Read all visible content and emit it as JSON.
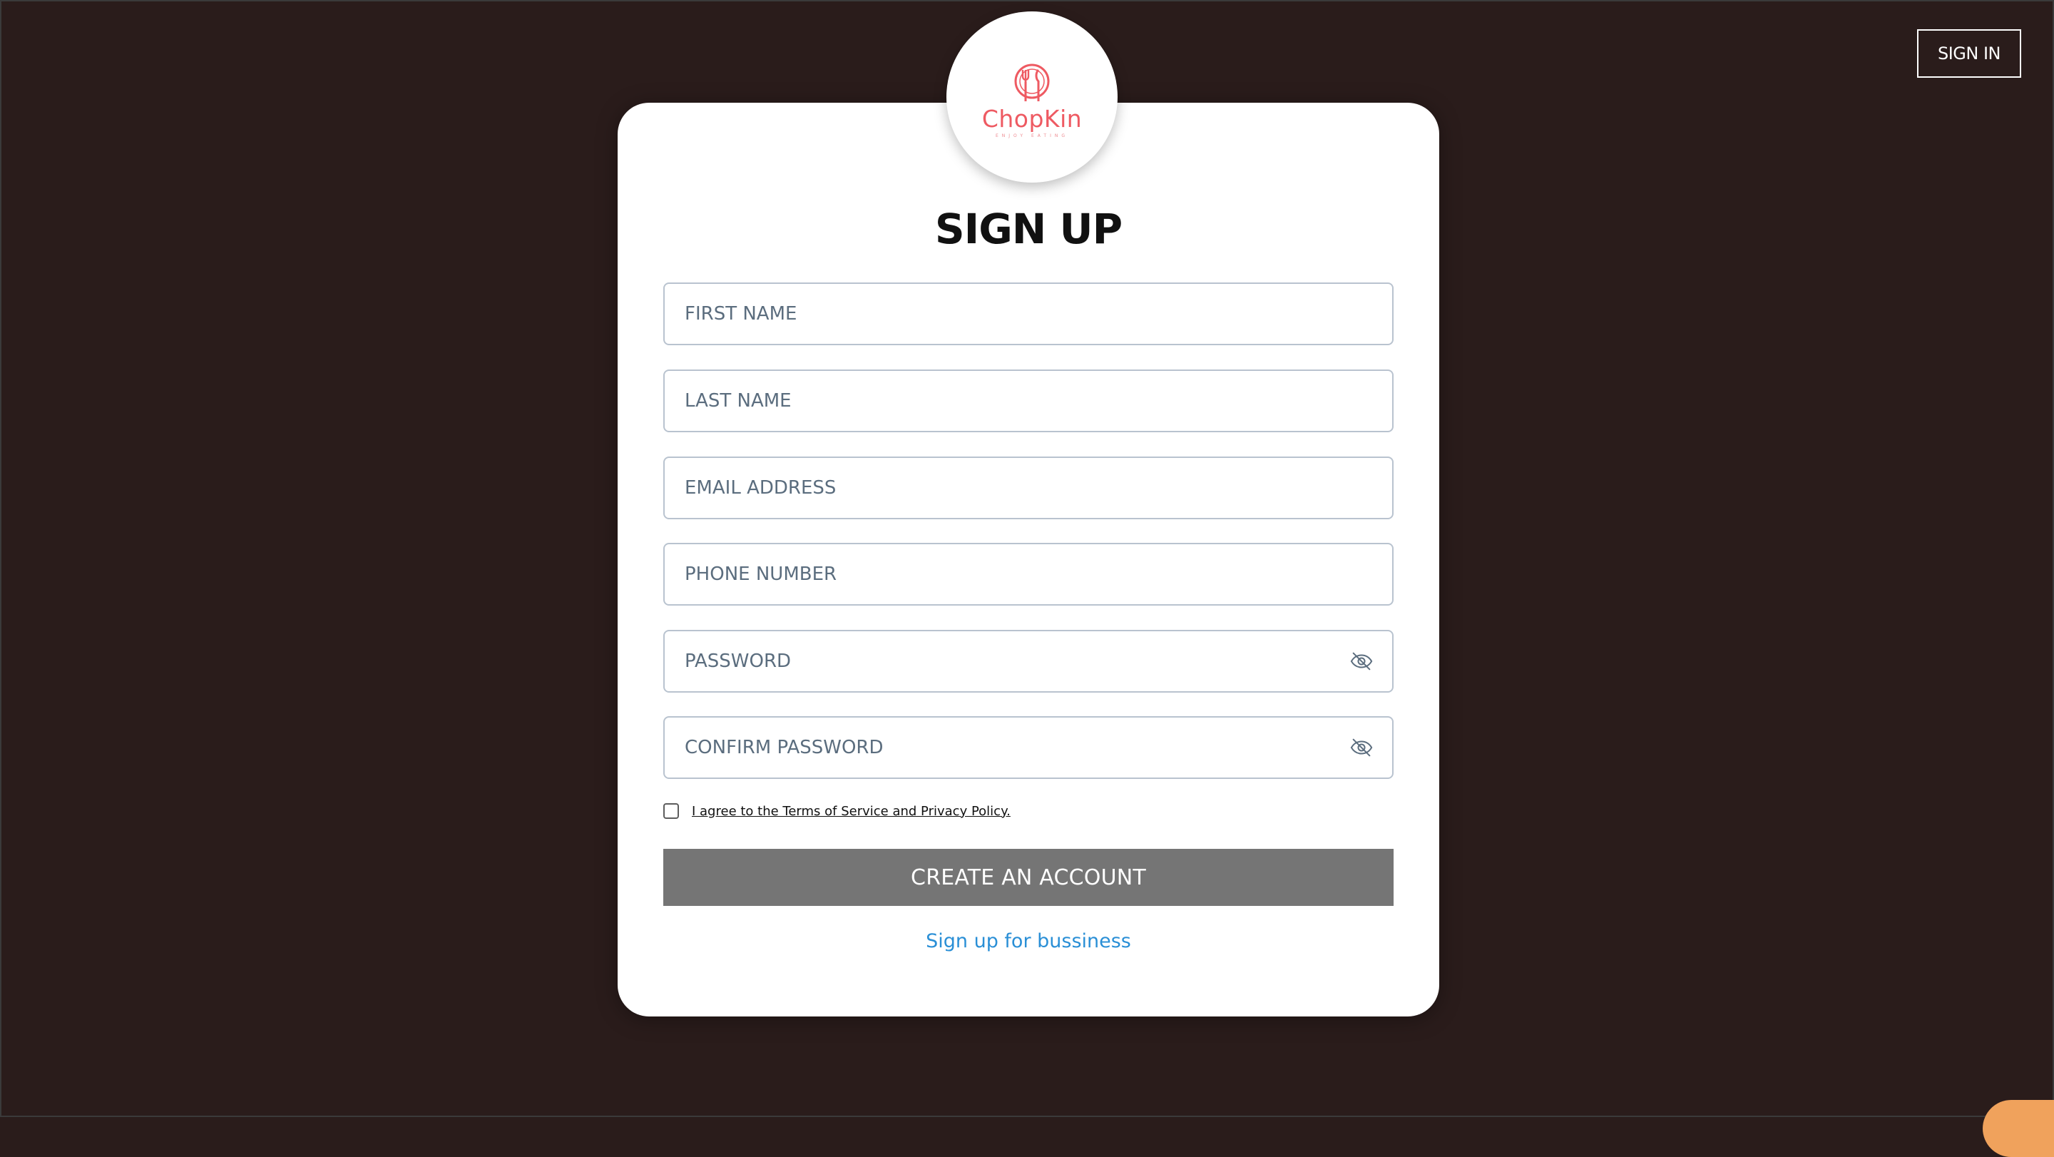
{
  "header": {
    "sign_in_label": "SIGN IN"
  },
  "logo": {
    "name": "ChopKin",
    "tagline": "ENJOY EATING",
    "icon": "fork-knife-plate-icon",
    "color": "#ee5a62"
  },
  "form": {
    "title": "SIGN UP",
    "fields": [
      {
        "placeholder": "FIRST NAME",
        "value": ""
      },
      {
        "placeholder": "LAST NAME",
        "value": ""
      },
      {
        "placeholder": "EMAIL ADDRESS",
        "value": ""
      },
      {
        "placeholder": "PHONE NUMBER",
        "value": ""
      },
      {
        "placeholder": "PASSWORD",
        "value": "",
        "icon": "eye-slash-icon"
      },
      {
        "placeholder": "CONFIRM PASSWORD",
        "value": "",
        "icon": "eye-slash-icon"
      }
    ],
    "terms_label": "I agree to the Terms of Service and Privacy Policy.",
    "terms_checked": false,
    "submit_label": "CREATE AN ACCOUNT",
    "business_link": "Sign up for bussiness"
  },
  "colors": {
    "background": "#2a1c1b",
    "card": "#ffffff",
    "button": "#757575",
    "link": "#2a8fd6",
    "accent": "#f0a25c"
  }
}
